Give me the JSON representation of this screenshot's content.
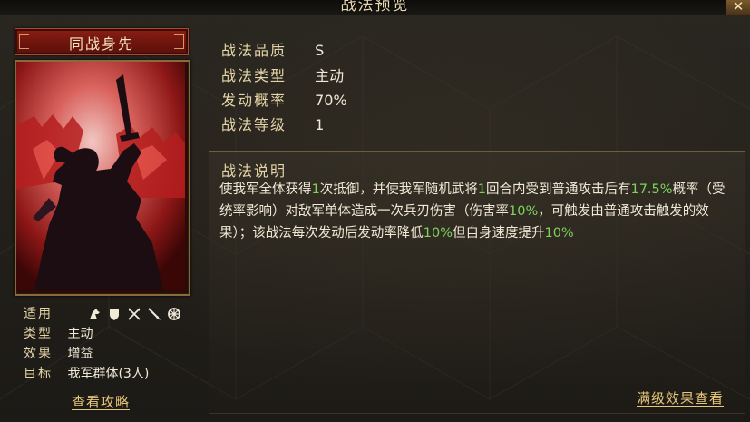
{
  "window": {
    "title": "战法预览",
    "close_label": "✕"
  },
  "skill": {
    "name": "同战身先",
    "art": "silhouette of a warrior raising a sword before a red army"
  },
  "meta": {
    "applicable_label": "适用",
    "applicable_units": [
      "cavalry-icon",
      "shield-icon",
      "bow-icon",
      "spear-icon",
      "siege-icon"
    ],
    "type_label": "类型",
    "type_value": "主动",
    "effect_label": "效果",
    "effect_value": "增益",
    "target_label": "目标",
    "target_value": "我军群体(3人)",
    "guide_link": "查看攻略"
  },
  "stats": {
    "quality_label": "战法品质",
    "quality_value": "S",
    "kind_label": "战法类型",
    "kind_value": "主动",
    "chance_label": "发动概率",
    "chance_value": "70%",
    "level_label": "战法等级",
    "level_value": "1"
  },
  "description": {
    "title": "战法说明",
    "segments": [
      {
        "text": "使我军全体获得",
        "hl": false
      },
      {
        "text": "1",
        "hl": true
      },
      {
        "text": "次抵御，并使我军随机武将",
        "hl": false
      },
      {
        "text": "1",
        "hl": true
      },
      {
        "text": "回合内受到普通攻击后有",
        "hl": false
      },
      {
        "text": "17.5%",
        "hl": true
      },
      {
        "text": "概率（受统率影响）对敌军单体造成一次兵刃伤害（伤害率",
        "hl": false
      },
      {
        "text": "10%",
        "hl": true
      },
      {
        "text": "，可触发由普通攻击触发的效果）；该战法每次发动后发动率降低",
        "hl": false
      },
      {
        "text": "10%",
        "hl": true
      },
      {
        "text": "但自身速度提升",
        "hl": false
      },
      {
        "text": "10%",
        "hl": true
      }
    ],
    "full_level_link": "满级效果查看"
  },
  "colors": {
    "highlight": "#7ed25a",
    "gold_text": "#e6d5a8",
    "link": "#e9c77a",
    "banner_red": "#8a1f15"
  }
}
